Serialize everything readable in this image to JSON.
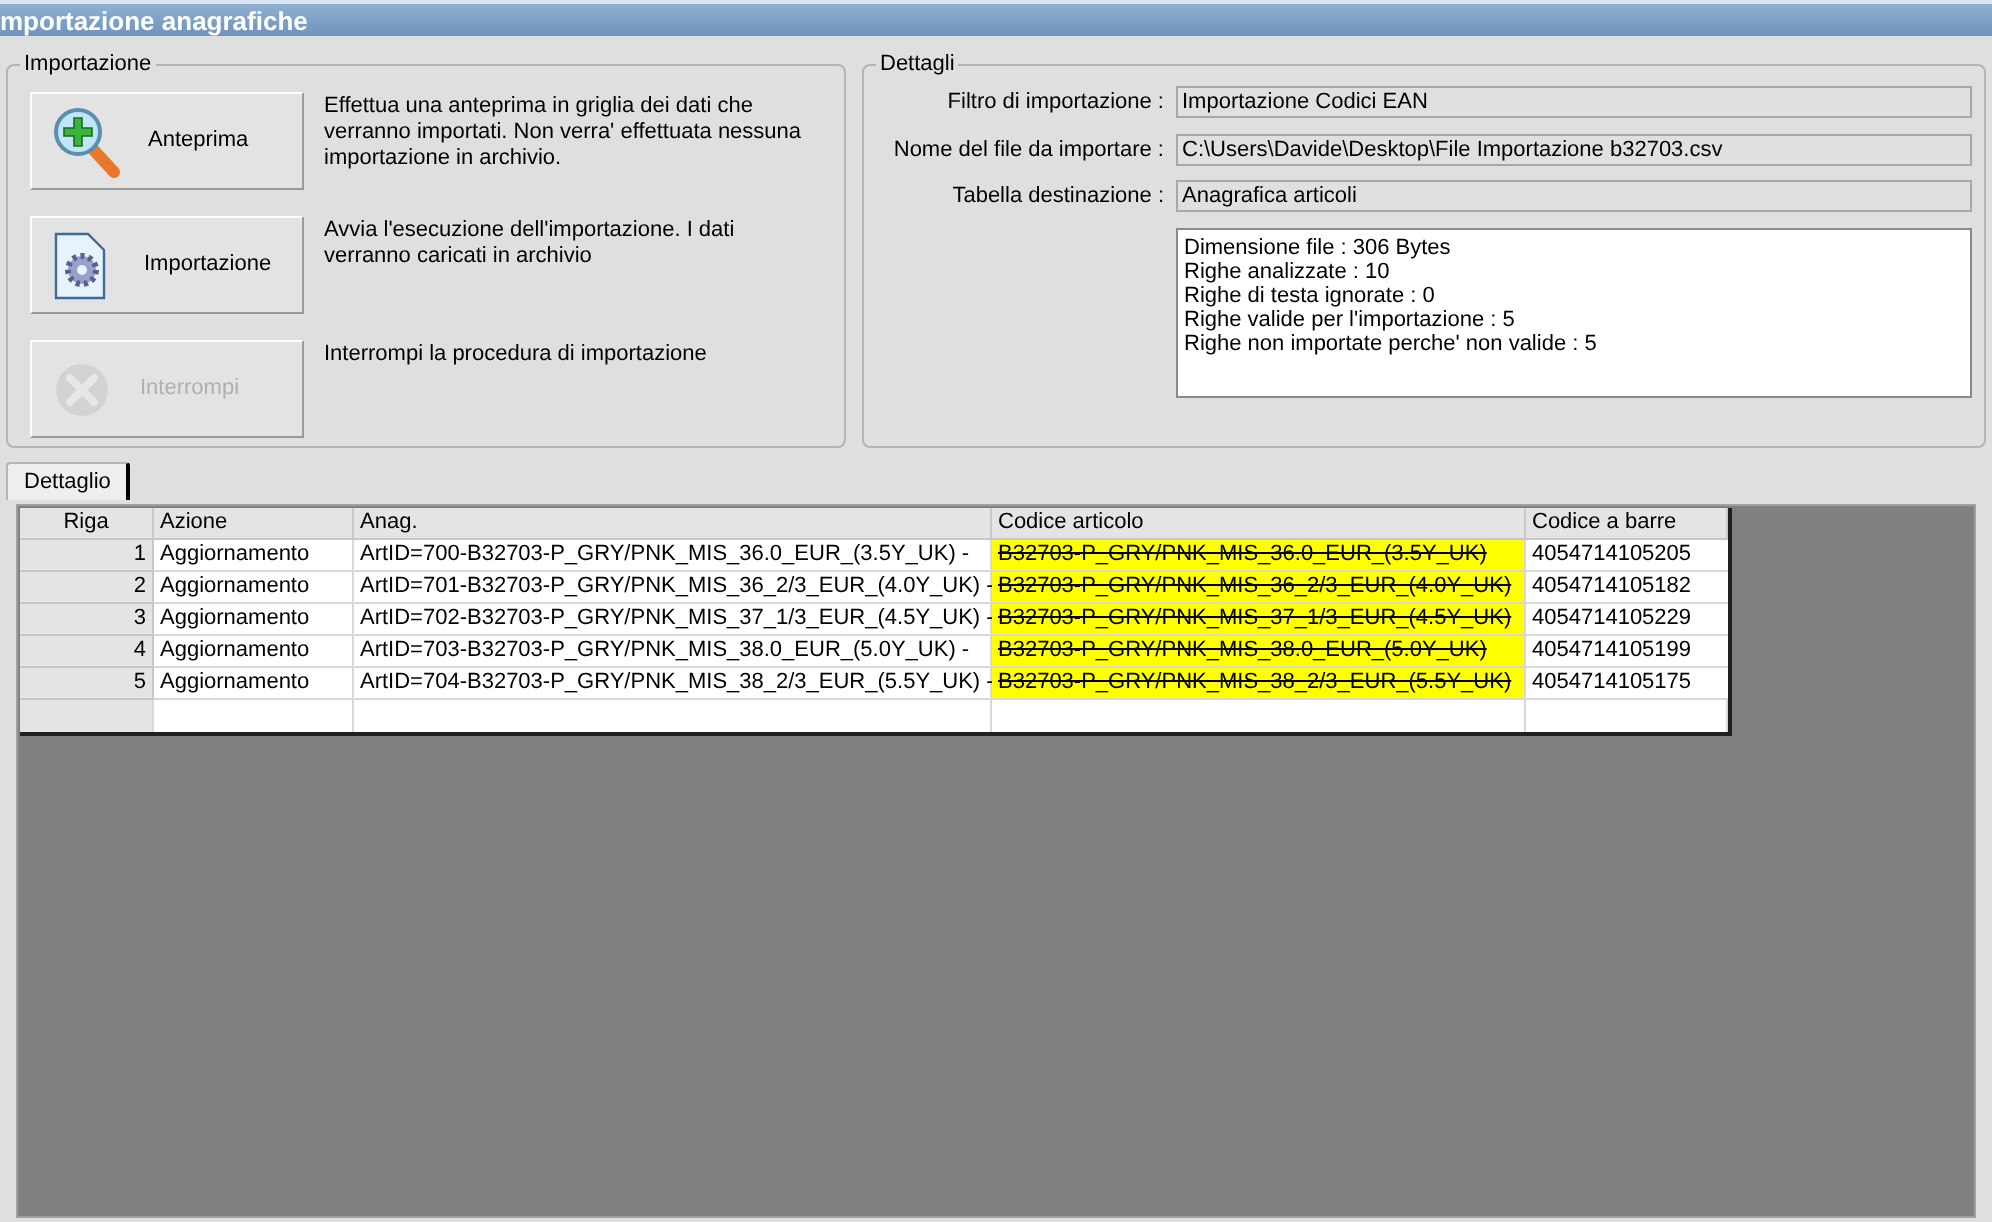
{
  "window": {
    "title": "mportazione anagrafiche"
  },
  "import_group": {
    "title": "Importazione",
    "actions": [
      {
        "label": "Anteprima",
        "kind": "preview",
        "disabled": false,
        "description": "Effettua una anteprima in griglia dei dati che verranno importati. Non verra' effettuata nessuna importazione in archivio."
      },
      {
        "label": "Importazione",
        "kind": "import",
        "disabled": false,
        "description": "Avvia l'esecuzione dell'importazione. I dati verranno caricati in archivio"
      },
      {
        "label": "Interrompi",
        "kind": "stop",
        "disabled": true,
        "description": "Interrompi la procedura di importazione"
      }
    ]
  },
  "details_group": {
    "title": "Dettagli",
    "fields": [
      {
        "label": "Filtro di importazione :",
        "value": "Importazione Codici EAN"
      },
      {
        "label": "Nome del file da importare :",
        "value": "C:\\Users\\Davide\\Desktop\\File Importazione b32703.csv"
      },
      {
        "label": "Tabella destinazione :",
        "value": "Anagrafica articoli"
      }
    ],
    "summary": [
      "Dimensione file : 306 Bytes",
      "Righe analizzate : 10",
      "Righe di testa ignorate : 0",
      "Righe valide per l'importazione : 5",
      "Righe non importate perche' non valide : 5"
    ]
  },
  "tabs": [
    {
      "label": "Dettaglio",
      "selected": true
    }
  ],
  "table": {
    "columns": [
      "Riga",
      "Azione",
      "Anag.",
      "Codice articolo",
      "Codice a barre"
    ],
    "rows": [
      {
        "riga": "1",
        "azione": "Aggiornamento",
        "anag": "ArtID=700-B32703-P_GRY/PNK_MIS_36.0_EUR_(3.5Y_UK) -",
        "codice": "B32703-P_GRY/PNK_MIS_36.0_EUR_(3.5Y_UK)",
        "struck": true,
        "barcode": "4054714105205"
      },
      {
        "riga": "2",
        "azione": "Aggiornamento",
        "anag": "ArtID=701-B32703-P_GRY/PNK_MIS_36_2/3_EUR_(4.0Y_UK) -",
        "codice": "B32703-P_GRY/PNK_MIS_36_2/3_EUR_(4.0Y_UK)",
        "struck": true,
        "barcode": "4054714105182"
      },
      {
        "riga": "3",
        "azione": "Aggiornamento",
        "anag": "ArtID=702-B32703-P_GRY/PNK_MIS_37_1/3_EUR_(4.5Y_UK) -",
        "codice": "B32703-P_GRY/PNK_MIS_37_1/3_EUR_(4.5Y_UK)",
        "struck": true,
        "barcode": "4054714105229"
      },
      {
        "riga": "4",
        "azione": "Aggiornamento",
        "anag": "ArtID=703-B32703-P_GRY/PNK_MIS_38.0_EUR_(5.0Y_UK) -",
        "codice": "B32703-P_GRY/PNK_MIS_38.0_EUR_(5.0Y_UK)",
        "struck": true,
        "barcode": "4054714105199"
      },
      {
        "riga": "5",
        "azione": "Aggiornamento",
        "anag": "ArtID=704-B32703-P_GRY/PNK_MIS_38_2/3_EUR_(5.5Y_UK) -",
        "codice": "B32703-P_GRY/PNK_MIS_38_2/3_EUR_(5.5Y_UK)",
        "struck": true,
        "barcode": "4054714105175"
      }
    ]
  }
}
